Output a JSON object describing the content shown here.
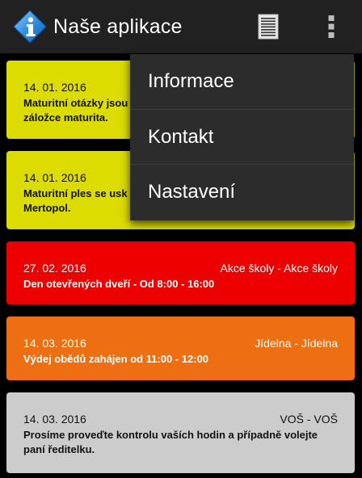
{
  "app_bar": {
    "title": "Naše aplikace",
    "icon": "info-diamond-icon",
    "actions": [
      {
        "icon": "list-document-icon"
      },
      {
        "icon": "overflow-menu-icon"
      }
    ]
  },
  "menu": {
    "items": [
      {
        "label": "Informace"
      },
      {
        "label": "Kontakt"
      },
      {
        "label": "Nastavení"
      }
    ]
  },
  "cards": [
    {
      "date": "14. 01. 2016",
      "category": "",
      "message": "Maturitní otázky jsou\nzáložce maturita.",
      "color": "#dcdc00"
    },
    {
      "date": "14. 01. 2016",
      "category": "",
      "message": "Maturitní ples se usk\nMertopol.",
      "color": "#dcdc00"
    },
    {
      "date": "27. 02. 2016",
      "category": "Akce školy - Akce školy",
      "message": "Den otevřených dveří - Od 8:00 - 16:00",
      "color": "#ee0000"
    },
    {
      "date": "14. 03. 2016",
      "category": "Jídelna - Jídelna",
      "message": "Výdej obědů zahájen od 11:00 - 12:00",
      "color": "#ee6e12"
    },
    {
      "date": "14. 03. 2016",
      "category": "VOŠ - VOŠ",
      "message": "Prosíme proveďte kontrolu vaších hodin a případně volejte\npaní ředitelku.",
      "color": "#cccccc"
    }
  ]
}
